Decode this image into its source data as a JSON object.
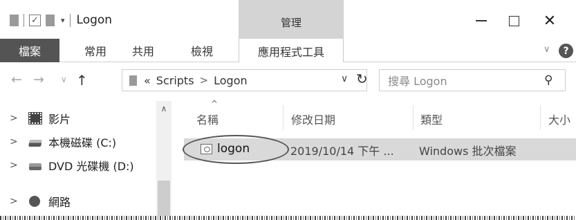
{
  "window": {
    "title": "Logon",
    "contextual_tab_header": "管理",
    "quick_access_dropdown": "▾"
  },
  "ribbon": {
    "tabs": [
      "檔案",
      "常用",
      "共用",
      "檢視",
      "應用程式工具"
    ],
    "expand_glyph": "∨",
    "help_glyph": "?"
  },
  "address_bar": {
    "overflow": "«",
    "path": [
      "Scripts",
      "Logon"
    ],
    "separator": ">",
    "dropdown_glyph": "∨"
  },
  "search": {
    "placeholder": "搜尋 Logon"
  },
  "navigation_pane": {
    "items": [
      {
        "label": "影片",
        "icon": "video-folder-icon"
      },
      {
        "label": "本機磁碟 (C:)",
        "icon": "local-disk-icon"
      },
      {
        "label": "DVD 光碟機 (D:)",
        "icon": "dvd-drive-icon"
      },
      {
        "label": "網路",
        "icon": "network-icon"
      }
    ]
  },
  "file_list": {
    "columns": [
      "名稱",
      "修改日期",
      "類型",
      "大小"
    ],
    "rows": [
      {
        "name": "logon",
        "modified": "2019/10/14 下午 ...",
        "type": "Windows 批次檔案",
        "icon": "batch-file-icon"
      }
    ]
  },
  "colors": {
    "file_tab_bg": "#545454",
    "contextual_tab_bg": "#d4d4d4",
    "selected_row_bg": "#d9d9d9"
  }
}
